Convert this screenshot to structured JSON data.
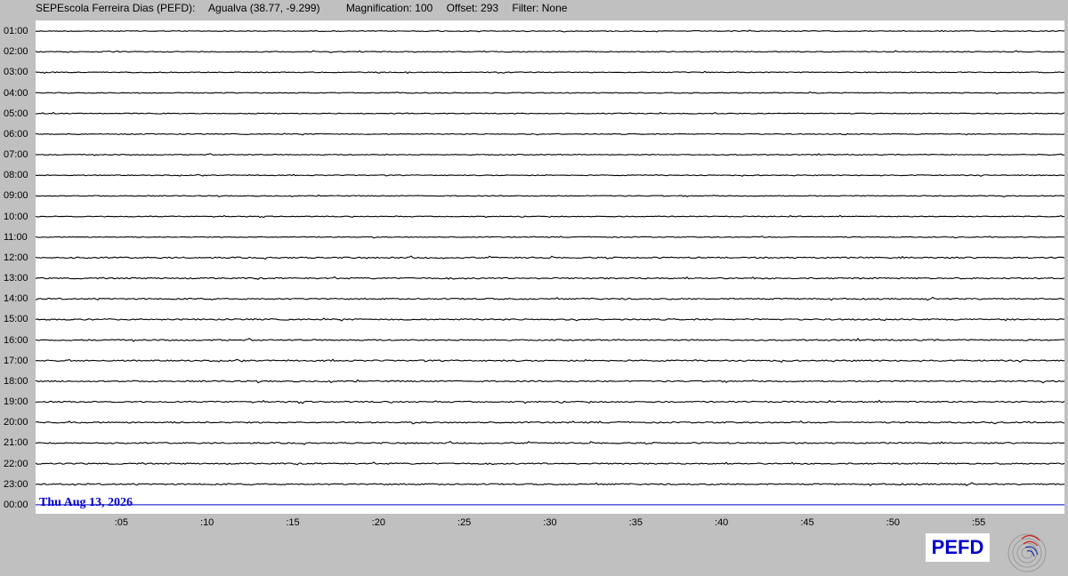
{
  "header": {
    "station": "SEPEscola Ferreira Dias (PEFD):",
    "location": "Agualva (38.77, -9.299)",
    "magnification": "Magnification: 100",
    "offset": "Offset: 293",
    "filter": "Filter: None"
  },
  "date_label": "Thu Aug 13, 2026",
  "logo_text": "PEFD",
  "colors": {
    "background": "#c0c0c0",
    "plot": "#ffffff",
    "trace": "#000000",
    "current": "#0000cc"
  },
  "chart_data": {
    "type": "line",
    "rows": [
      "01:00",
      "02:00",
      "03:00",
      "04:00",
      "05:00",
      "06:00",
      "07:00",
      "08:00",
      "09:00",
      "10:00",
      "11:00",
      "12:00",
      "13:00",
      "14:00",
      "15:00",
      "16:00",
      "17:00",
      "18:00",
      "19:00",
      "20:00",
      "21:00",
      "22:00",
      "23:00",
      "00:00"
    ],
    "x_ticks": [
      ":05",
      ":10",
      ":15",
      ":20",
      ":25",
      ":30",
      ":35",
      ":40",
      ":45",
      ":50",
      ":55"
    ],
    "x_tick_values": [
      5,
      10,
      15,
      20,
      25,
      30,
      35,
      40,
      45,
      50,
      55
    ],
    "xlim": [
      0,
      60
    ],
    "current_row": "00:00"
  }
}
